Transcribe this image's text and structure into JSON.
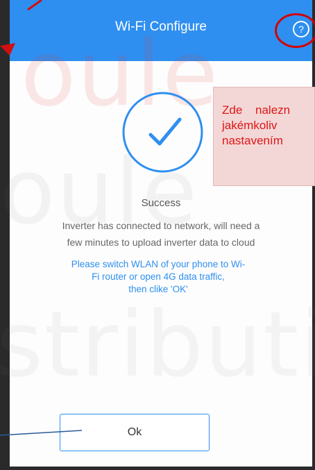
{
  "header": {
    "title": "Wi-Fi Configure",
    "help_glyph": "?"
  },
  "status": {
    "title": "Success",
    "description_lines": [
      "Inverter has connected to network, will need a",
      "few minutes to upload inverter data to cloud"
    ],
    "instruction_lines": [
      "Please switch WLAN of your phone to Wi-",
      "Fi router or open 4G data traffic,",
      "then clike 'OK'"
    ]
  },
  "ok_button": {
    "label": "Ok"
  },
  "annotation": {
    "note_lines": [
      "Zde nalezn",
      "jakémkoliv",
      "nastavením"
    ]
  },
  "colors": {
    "primary": "#2e8ff0",
    "annotation_red": "#d40000"
  },
  "icons": {
    "success": "check-circle-icon",
    "help": "help-circle-icon"
  }
}
